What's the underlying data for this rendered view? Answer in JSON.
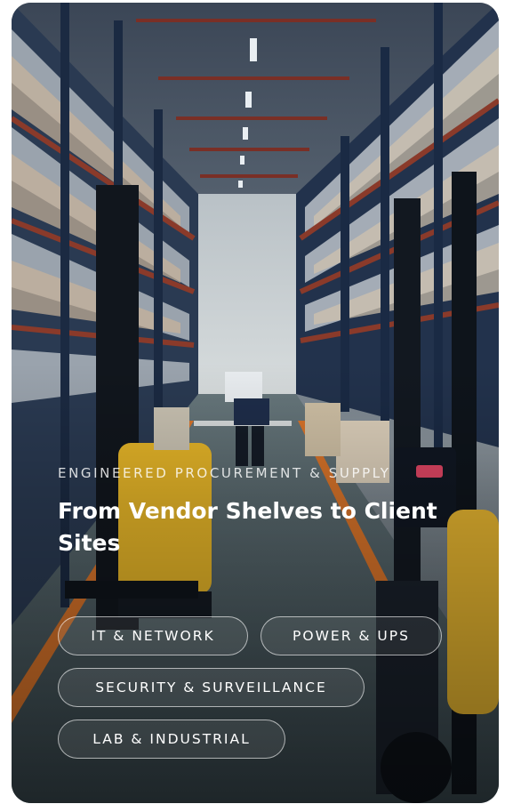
{
  "hero": {
    "eyebrow": "ENGINEERED PROCUREMENT & SUPPLY",
    "title": "From Vendor Shelves to Client Sites",
    "image_icon": "warehouse-photo"
  },
  "tags": [
    {
      "label": "IT & NETWORK"
    },
    {
      "label": "POWER & UPS"
    },
    {
      "label": "SECURITY & SURVEILLANCE"
    },
    {
      "label": "LAB & INDUSTRIAL"
    }
  ],
  "colors": {
    "accent_orange": "#d9742a",
    "rack_blue": "#1e3350",
    "forklift_yellow": "#e7b628",
    "floor": "#4a5a61"
  }
}
